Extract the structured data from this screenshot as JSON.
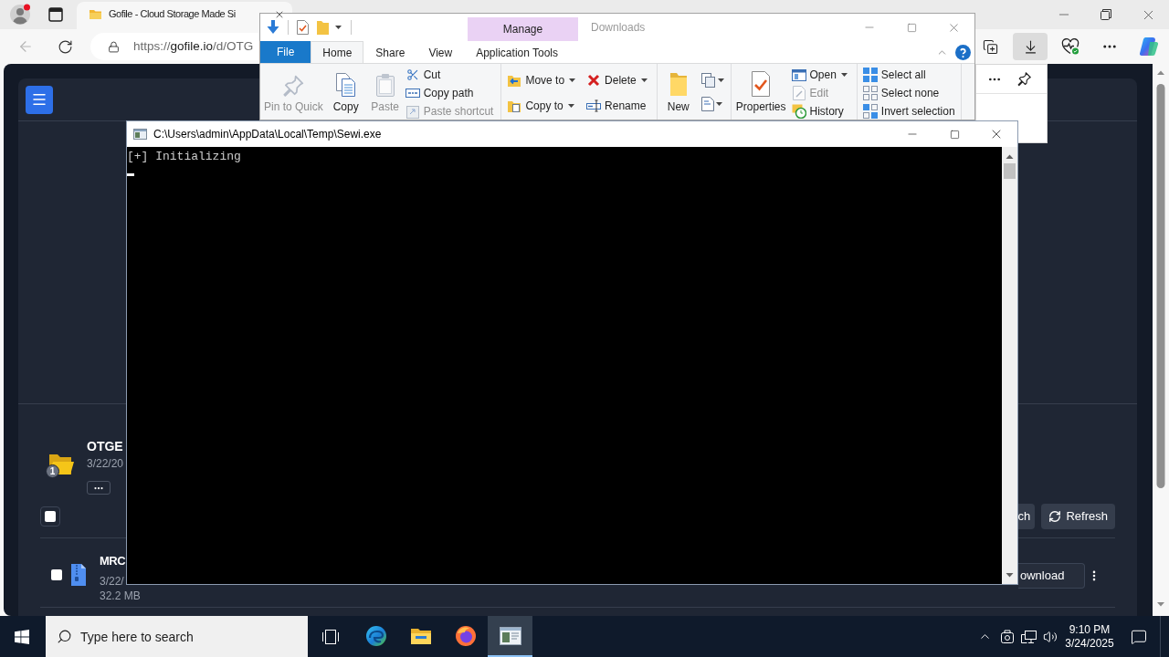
{
  "browser": {
    "tabs": [
      {
        "title": "Gofile - Cloud Storage Made Si",
        "selected": true
      }
    ],
    "address": {
      "scheme": "https://",
      "domain": "gofile.io",
      "path": "/d/OTG"
    },
    "downloads_button": {
      "selected": true
    }
  },
  "page": {
    "folder": {
      "name": "OTGE",
      "date": "3/22/20",
      "badge": "1"
    },
    "select_all": {
      "checked": false
    },
    "toolbar_buttons": [
      {
        "kind": "plain",
        "label": "ch"
      },
      {
        "kind": "refresh",
        "label": "Refresh"
      }
    ],
    "files": [
      {
        "name": "MRC",
        "date": "3/22/",
        "size": "32.2 MB",
        "checked": false,
        "action": "ownload"
      }
    ]
  },
  "explorer": {
    "context_tab": "Manage",
    "title": "Downloads",
    "tabs": [
      {
        "label": "File",
        "kind": "file",
        "selected": false
      },
      {
        "label": "Home",
        "kind": "tab",
        "selected": true
      },
      {
        "label": "Share",
        "kind": "tab",
        "selected": false
      },
      {
        "label": "View",
        "kind": "tab",
        "selected": false
      },
      {
        "label": "Application Tools",
        "kind": "tab",
        "selected": false
      }
    ],
    "ribbon": [
      {
        "items": [
          {
            "kind": "large",
            "label": "Pin to Quick",
            "disabled": true
          },
          {
            "kind": "large",
            "label": "Copy",
            "disabled": false
          },
          {
            "kind": "large",
            "label": "Paste",
            "disabled": true
          },
          {
            "kind": "stack",
            "commands": [
              {
                "label": "Cut",
                "disabled": false,
                "dropdown": false
              },
              {
                "label": "Copy path",
                "disabled": false,
                "dropdown": false
              },
              {
                "label": "Paste shortcut",
                "disabled": true,
                "dropdown": false
              }
            ]
          }
        ]
      },
      {
        "items": [
          {
            "kind": "stack",
            "commands": [
              {
                "label": "Move to",
                "disabled": false,
                "dropdown": true
              },
              {
                "label": "Copy to",
                "disabled": false,
                "dropdown": true
              }
            ]
          },
          {
            "kind": "stack",
            "commands": [
              {
                "label": "Delete",
                "disabled": false,
                "dropdown": true
              },
              {
                "label": "Rename",
                "disabled": false,
                "dropdown": false
              }
            ]
          }
        ]
      },
      {
        "items": [
          {
            "kind": "large",
            "label": "New",
            "disabled": false
          },
          {
            "kind": "icon_stack"
          }
        ]
      },
      {
        "items": [
          {
            "kind": "large",
            "label": "Properties",
            "disabled": false
          },
          {
            "kind": "stack",
            "commands": [
              {
                "label": "Open",
                "disabled": false,
                "dropdown": true
              },
              {
                "label": "Edit",
                "disabled": true,
                "dropdown": false
              },
              {
                "label": "History",
                "disabled": false,
                "dropdown": false
              }
            ]
          }
        ]
      },
      {
        "items": [
          {
            "kind": "stack",
            "commands": [
              {
                "label": "Select all",
                "disabled": false,
                "dropdown": false
              },
              {
                "label": "Select none",
                "disabled": false,
                "dropdown": false
              },
              {
                "label": "Invert selection",
                "disabled": false,
                "dropdown": false
              }
            ]
          }
        ]
      }
    ]
  },
  "console": {
    "title": "C:\\Users\\admin\\AppData\\Local\\Temp\\Sewi.exe",
    "lines": [
      "[+] Initializing"
    ]
  },
  "taskbar": {
    "search": {
      "placeholder": "Type here to search"
    },
    "apps": [
      {
        "selected": false
      },
      {
        "selected": false
      },
      {
        "selected": false
      },
      {
        "selected": true
      }
    ],
    "time": "9:10 PM",
    "date": "3/24/2025"
  }
}
